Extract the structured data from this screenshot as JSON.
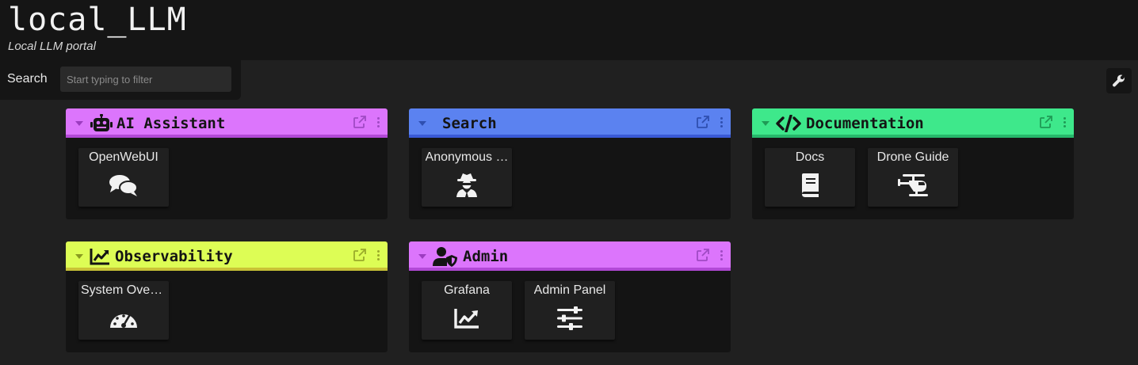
{
  "header": {
    "title": "local_LLM",
    "subtitle": "Local LLM portal"
  },
  "search": {
    "label": "Search",
    "placeholder": "Start typing to filter"
  },
  "settings": {
    "icon": "wrench-icon"
  },
  "sections": [
    {
      "title": "AI Assistant",
      "icon": "robot-icon",
      "color": "#dc75fc",
      "bar_color": "#b249d6",
      "items": [
        {
          "label": "OpenWebUI",
          "icon": "comments-icon"
        }
      ]
    },
    {
      "title": "Search",
      "icon": "",
      "color": "#5b82f0",
      "bar_color": "#3a5ad6",
      "items": [
        {
          "label": "Anonymous …",
          "icon": "user-secret-icon"
        }
      ]
    },
    {
      "title": "Documentation",
      "icon": "code-icon",
      "color": "#3ee88b",
      "bar_color": "#26b86b",
      "items": [
        {
          "label": "Docs",
          "icon": "book-icon"
        },
        {
          "label": "Drone Guide",
          "icon": "helicopter-icon"
        }
      ]
    },
    {
      "title": "Observability",
      "icon": "chart-line-icon",
      "color": "#ddfd55",
      "bar_color": "#c9c236",
      "items": [
        {
          "label": "System Over…",
          "icon": "gauge-icon"
        }
      ]
    },
    {
      "title": "Admin",
      "icon": "user-shield-icon",
      "color": "#dc75fc",
      "bar_color": "#b249d6",
      "items": [
        {
          "label": "Grafana",
          "icon": "chart-line-icon"
        },
        {
          "label": "Admin Panel",
          "icon": "sliders-icon"
        }
      ]
    }
  ]
}
